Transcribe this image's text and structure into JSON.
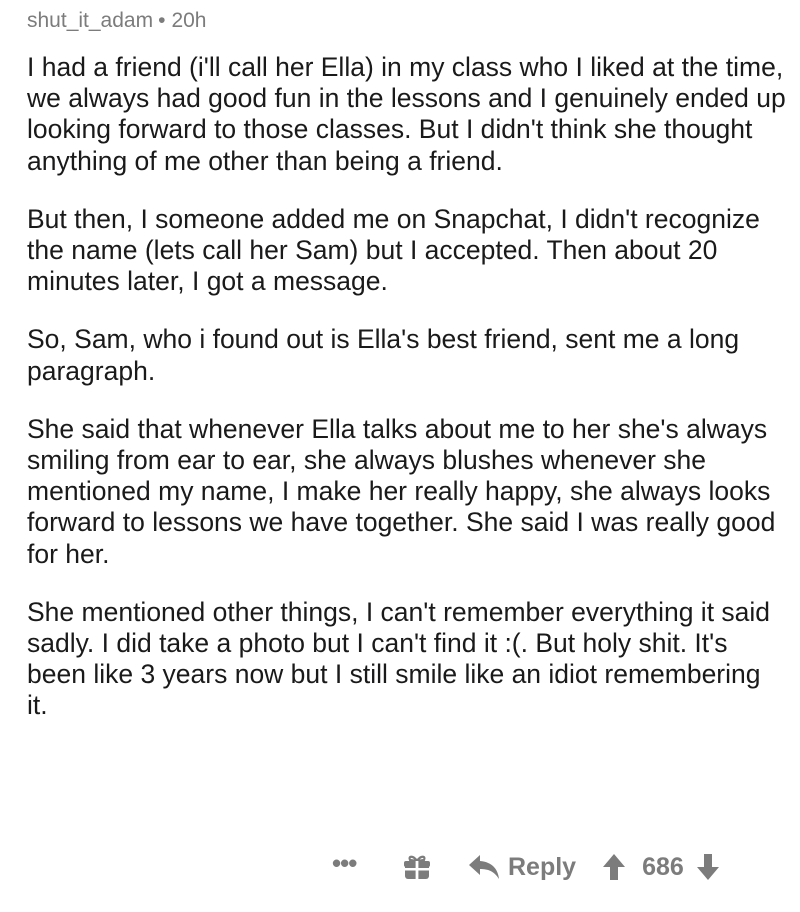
{
  "comment": {
    "author": "shut_it_adam",
    "separator": "•",
    "age": "20h",
    "paragraphs": [
      "I had a friend (i'll call her Ella) in my class who I liked at the time, we always had good fun in the lessons and I genuinely ended up looking forward to those classes. But I didn't think she thought anything of me other than being a friend.",
      "But then, I someone added me on Snapchat, I didn't recognize the name (lets call her Sam) but I accepted. Then about 20 minutes later, I got a message.",
      "So, Sam, who i found out is Ella's best friend, sent me a long paragraph.",
      "She said that whenever Ella talks about me to her she's always smiling from ear to ear, she always blushes whenever she mentioned my name, I make her really happy, she always looks forward to lessons we have together. She said I was really good for her.",
      "She mentioned other things, I can't remember everything it said sadly. I did take a photo but I can't find it :(. But holy shit. It's been like 3 years now but I still smile like an idiot remembering it."
    ]
  },
  "actions": {
    "more_label": "•••",
    "more_icon": "more-dots-icon",
    "gift_icon": "gift-icon",
    "reply_icon": "reply-arrow-icon",
    "reply_label": "Reply",
    "upvote_icon": "upvote-arrow-icon",
    "score": "686",
    "downvote_icon": "downvote-arrow-icon"
  },
  "colors": {
    "text": "#1a1a1b",
    "meta": "#7c7c7c",
    "background": "#ffffff"
  }
}
